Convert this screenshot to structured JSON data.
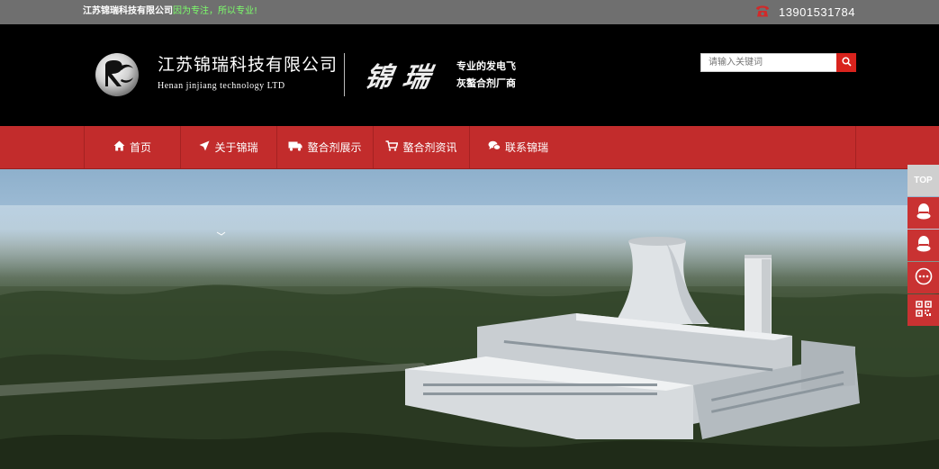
{
  "topbar": {
    "company": "江苏锦瑞科技有限公司",
    "slogan": "因为专注，所以专业!",
    "phone": "13901531784",
    "phone_icon": "phone-icon"
  },
  "header": {
    "brand_cn": "江苏锦瑞科技有限公司",
    "brand_en": "Henan jinjiang technology LTD",
    "calligraphy": "锦瑞",
    "tagline_1": "专业的发电飞",
    "tagline_2": "灰螯合剂厂商"
  },
  "search": {
    "placeholder": "请输入关键词",
    "icon": "search-icon"
  },
  "nav": {
    "items": [
      {
        "label": "首页",
        "icon": "home-icon"
      },
      {
        "label": "关于锦瑞",
        "icon": "send-icon"
      },
      {
        "label": "螯合剂展示",
        "icon": "truck-icon"
      },
      {
        "label": "螯合剂资讯",
        "icon": "cart-icon"
      },
      {
        "label": "联系锦瑞",
        "icon": "chat-icon"
      }
    ]
  },
  "sidebar": {
    "top_label": "TOP",
    "items": [
      "qq-icon",
      "qq-icon",
      "message-icon",
      "qr-code-icon"
    ]
  },
  "colors": {
    "topbar_bg": "#6f6f6f",
    "slogan": "#7cff6b",
    "nav_bg": "#c22c2c",
    "search_button": "#d9231d",
    "sidebar_button": "#c93232"
  }
}
